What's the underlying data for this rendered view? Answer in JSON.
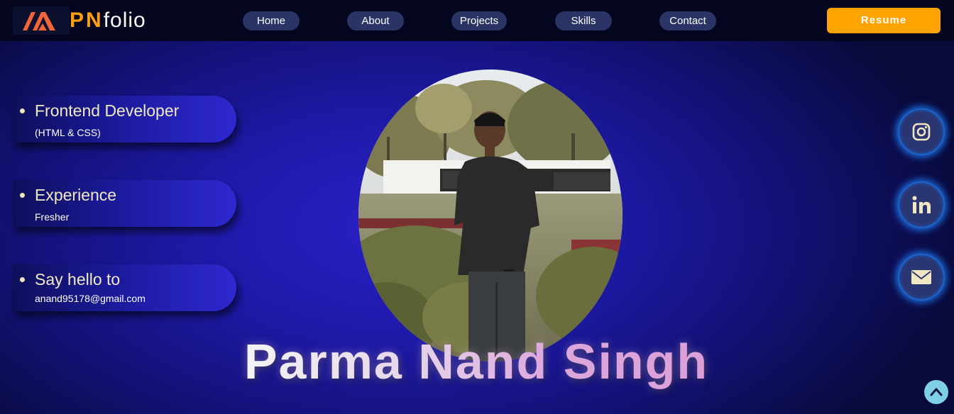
{
  "brand": {
    "logo_icon": "pn-logo-mark",
    "initials": "PN",
    "word": "folio",
    "accent_color": "#ff9f0a"
  },
  "nav": {
    "items": [
      "Home",
      "About",
      "Projects",
      "Skills",
      "Contact"
    ],
    "resume_label": "Resume",
    "resume_color": "#ffa400"
  },
  "cards": [
    {
      "title": "Frontend Developer",
      "subtitle": "(HTML & CSS)"
    },
    {
      "title": "Experience",
      "subtitle": "Fresher"
    },
    {
      "title": "Say hello to",
      "subtitle": "anand95178@gmail.com"
    }
  ],
  "hero": {
    "name": "Parma Nand Singh",
    "photo": "profile-photo"
  },
  "social": [
    {
      "icon": "instagram-icon"
    },
    {
      "icon": "linkedin-icon"
    },
    {
      "icon": "email-icon"
    }
  ],
  "scroll_top_icon": "chevron-up-icon"
}
